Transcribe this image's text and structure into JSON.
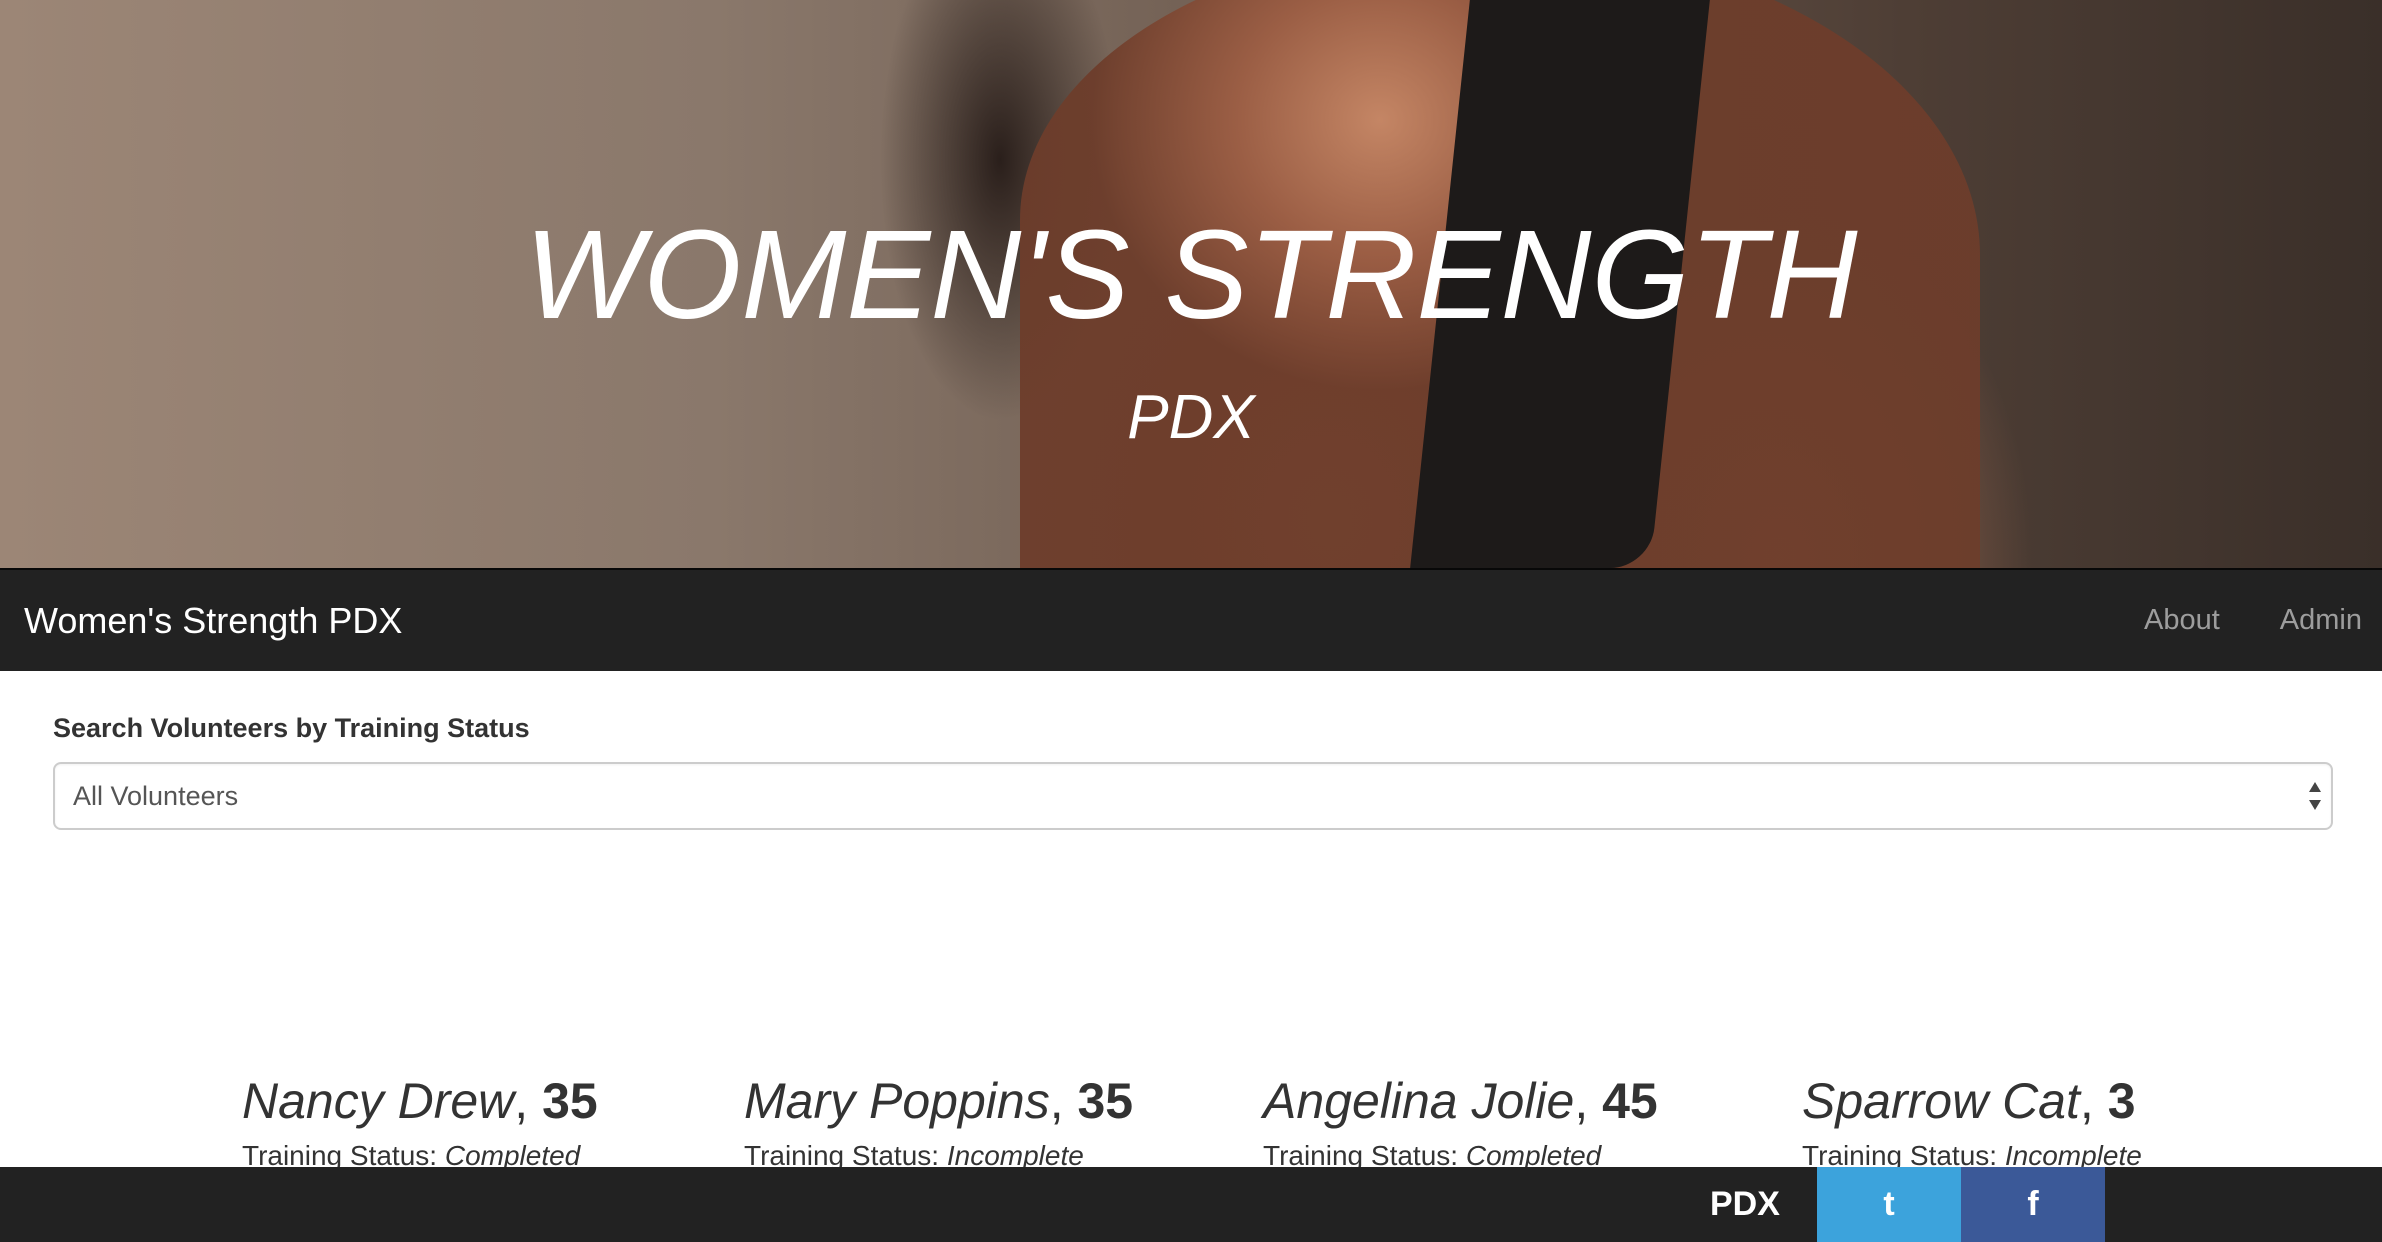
{
  "hero": {
    "title": "WOMEN'S STRENGTH",
    "subtitle": "PDX"
  },
  "navbar": {
    "brand": "Women's Strength PDX",
    "links": [
      "About",
      "Admin"
    ]
  },
  "search": {
    "label": "Search Volunteers by Training Status",
    "selected": "All Volunteers"
  },
  "volunteers": [
    {
      "name": "Nancy Drew",
      "age": "35",
      "status_label": "Training Status: ",
      "status": "Completed"
    },
    {
      "name": "Mary Poppins",
      "age": "35",
      "status_label": "Training Status: ",
      "status": "Incomplete"
    },
    {
      "name": "Angelina Jolie",
      "age": "45",
      "status_label": "Training Status: ",
      "status": "Completed"
    },
    {
      "name": "Sparrow Cat",
      "age": "3",
      "status_label": "Training Status: ",
      "status": "Incomplete"
    }
  ],
  "footer": {
    "brand": "PDX",
    "twitter_label": "t",
    "facebook_label": "f",
    "twitter_color": "#3ca3dc",
    "facebook_color": "#3b5998",
    "background": "#222222"
  }
}
